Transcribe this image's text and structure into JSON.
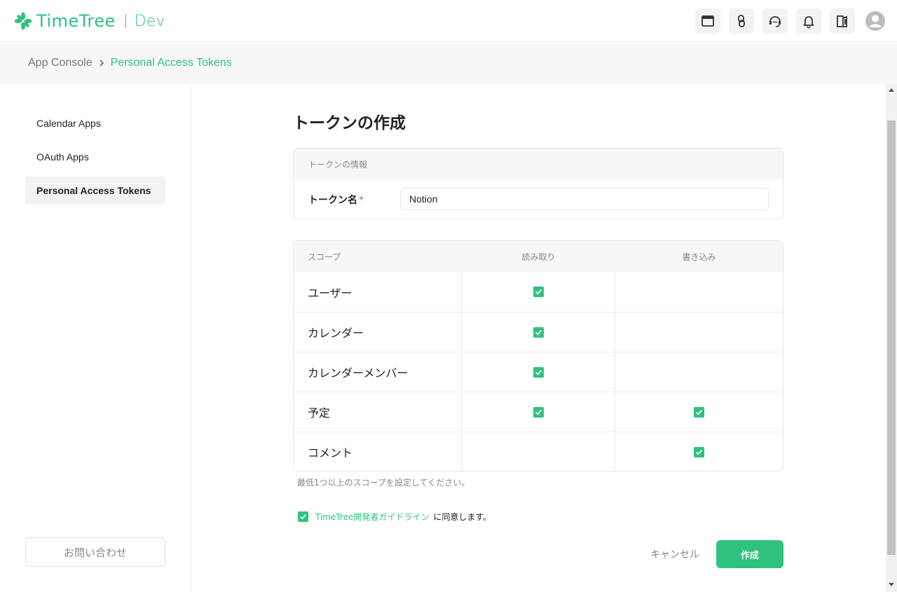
{
  "header": {
    "logo_text": "TimeTree",
    "logo_sub": "Dev",
    "icons": [
      "window-icon",
      "link-icon",
      "support-icon",
      "bell-icon",
      "docs-icon",
      "user-avatar-icon"
    ]
  },
  "breadcrumb": {
    "root": "App Console",
    "current": "Personal Access Tokens"
  },
  "sidebar": {
    "items": [
      {
        "label": "Calendar Apps",
        "active": false
      },
      {
        "label": "OAuth Apps",
        "active": false
      },
      {
        "label": "Personal Access Tokens",
        "active": true
      }
    ],
    "contact_label": "お問い合わせ"
  },
  "main": {
    "title": "トークンの作成",
    "info_card": {
      "heading": "トークンの情報",
      "name_label": "トークン名",
      "required_mark": "*",
      "name_value": "Notion"
    },
    "scope_table": {
      "headers": [
        "スコープ",
        "読み取り",
        "書き込み"
      ],
      "rows": [
        {
          "scope": "ユーザー",
          "read": true,
          "write": false
        },
        {
          "scope": "カレンダー",
          "read": true,
          "write": false
        },
        {
          "scope": "カレンダーメンバー",
          "read": true,
          "write": false
        },
        {
          "scope": "予定",
          "read": true,
          "write": true
        },
        {
          "scope": "コメント",
          "read": false,
          "write": true
        }
      ]
    },
    "hint": "最低1つ以上のスコープを設定してください。",
    "agree": {
      "link": "TimeTree開発者ガイドライン",
      "text": "に同意します。",
      "checked": true
    },
    "cancel_label": "キャンセル",
    "create_label": "作成"
  },
  "colors": {
    "brand": "#2ec27e",
    "muted": "#888888"
  }
}
